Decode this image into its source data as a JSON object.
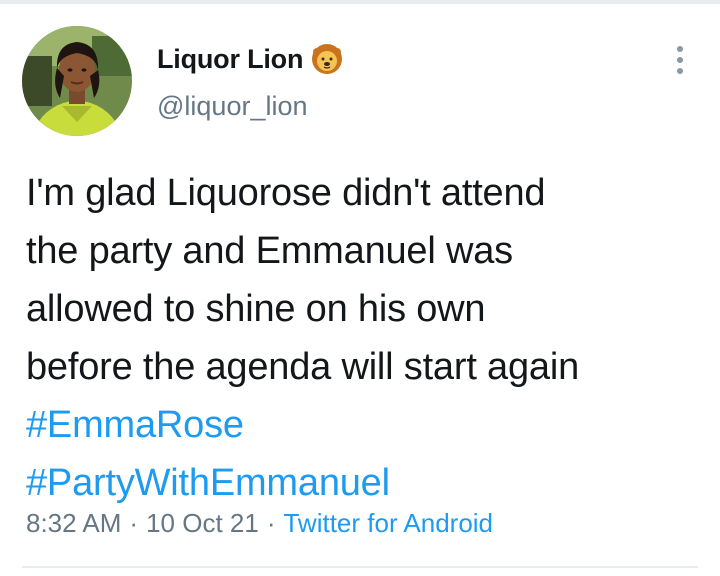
{
  "author": {
    "display_name": "Liquor Lion",
    "handle": "@liquor_lion",
    "badge_icon": "lion-face-icon"
  },
  "tweet": {
    "lines": [
      "I'm glad Liquorose didn't attend",
      "the party and Emmanuel was",
      "allowed to shine on his own",
      "before the agenda will start again"
    ],
    "hashtags": [
      "#EmmaRose",
      "#PartyWithEmmanuel"
    ]
  },
  "meta": {
    "time": "8:32 AM",
    "date": "10 Oct 21",
    "separator": "·",
    "source": "Twitter for Android"
  },
  "colors": {
    "link": "#1d9bf0",
    "secondary_text": "#657786",
    "primary_text": "#14171a"
  },
  "icons": {
    "more": "more-vertical-icon"
  }
}
